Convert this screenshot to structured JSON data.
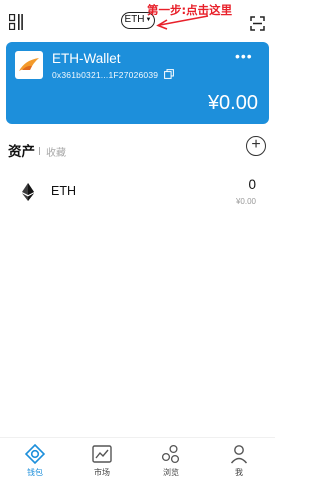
{
  "header": {
    "network": "ETH",
    "annotation": "第一步:点击这里"
  },
  "wallet": {
    "name": "ETH-Wallet",
    "address": "0x361b0321...1F27026039",
    "balance": "¥0.00"
  },
  "assets": {
    "tab_assets": "资产",
    "tab_collect": "收藏",
    "tokens": [
      {
        "symbol": "ETH",
        "amount": "0",
        "fiat": "¥0.00"
      }
    ]
  },
  "nav": {
    "items": [
      {
        "label": "钱包",
        "icon": "wallet-icon",
        "active": true
      },
      {
        "label": "市场",
        "icon": "market-icon",
        "active": false
      },
      {
        "label": "浏览",
        "icon": "browse-icon",
        "active": false
      },
      {
        "label": "我",
        "icon": "profile-icon",
        "active": false
      }
    ]
  },
  "colors": {
    "accent": "#1d8fdb",
    "annotation": "#e8202a"
  }
}
